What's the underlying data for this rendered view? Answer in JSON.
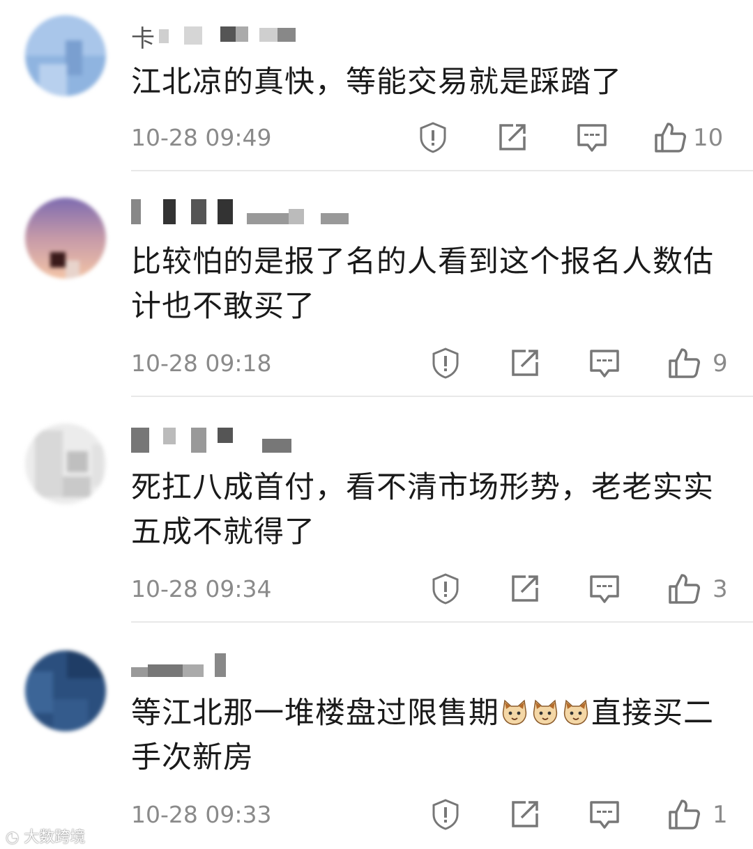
{
  "comments": [
    {
      "username": "卡",
      "text": "江北凉的真快，等能交易就是踩踏了",
      "time": "10-28 09:49",
      "likes": "10"
    },
    {
      "username": "",
      "text": "比较怕的是报了名的人看到这个报名人数估计也不敢买了",
      "time": "10-28 09:18",
      "likes": "9"
    },
    {
      "username": "",
      "text": "死扛八成首付，看不清市场形势，老老实实五成不就得了",
      "time": "10-28 09:34",
      "likes": "3"
    },
    {
      "username": "",
      "text_before_emoji": "等江北那一堆楼盘过限售期",
      "text_after_emoji": "直接买二手次新房",
      "emoji": [
        "cat-emoji",
        "cat-emoji",
        "cat-emoji"
      ],
      "time": "10-28 09:33",
      "likes": "1"
    }
  ],
  "icons": [
    "report-icon",
    "share-icon",
    "reply-icon",
    "thumbs-up-icon"
  ],
  "watermark": "大数跨境",
  "colors": {
    "text": "#1a1a1a",
    "meta": "#8a8a8a",
    "divider": "#e8e8e8"
  }
}
